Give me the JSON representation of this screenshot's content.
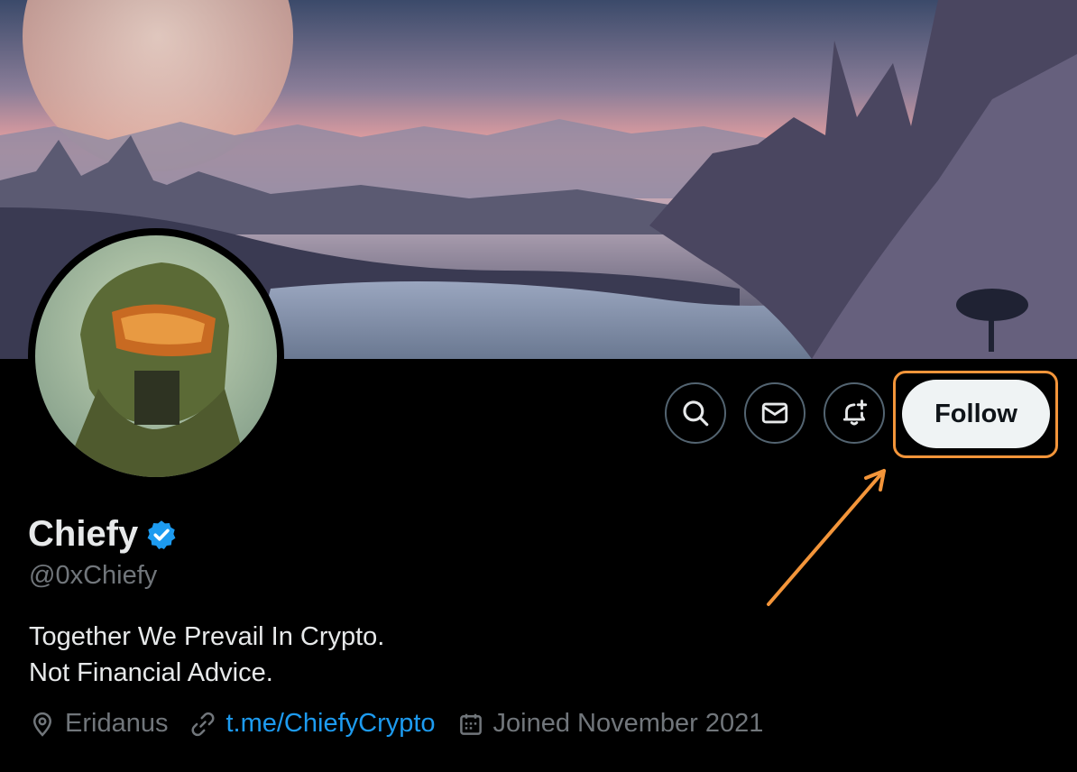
{
  "profile": {
    "display_name": "Chiefy",
    "verified": true,
    "handle": "@0xChiefy",
    "bio_line1": "Together We Prevail In Crypto.",
    "bio_line2": "Not Financial Advice.",
    "location": "Eridanus",
    "website": "t.me/ChiefyCrypto",
    "joined": "Joined November 2021"
  },
  "actions": {
    "search_icon": "search-icon",
    "message_icon": "envelope-icon",
    "notify_icon": "bell-plus-icon",
    "follow_label": "Follow"
  },
  "colors": {
    "background": "#000000",
    "follow_bg": "#eff3f4",
    "link": "#1d9bf0",
    "verified": "#1d9bf0",
    "muted_text": "#71767b",
    "highlight": "#f3953a"
  }
}
